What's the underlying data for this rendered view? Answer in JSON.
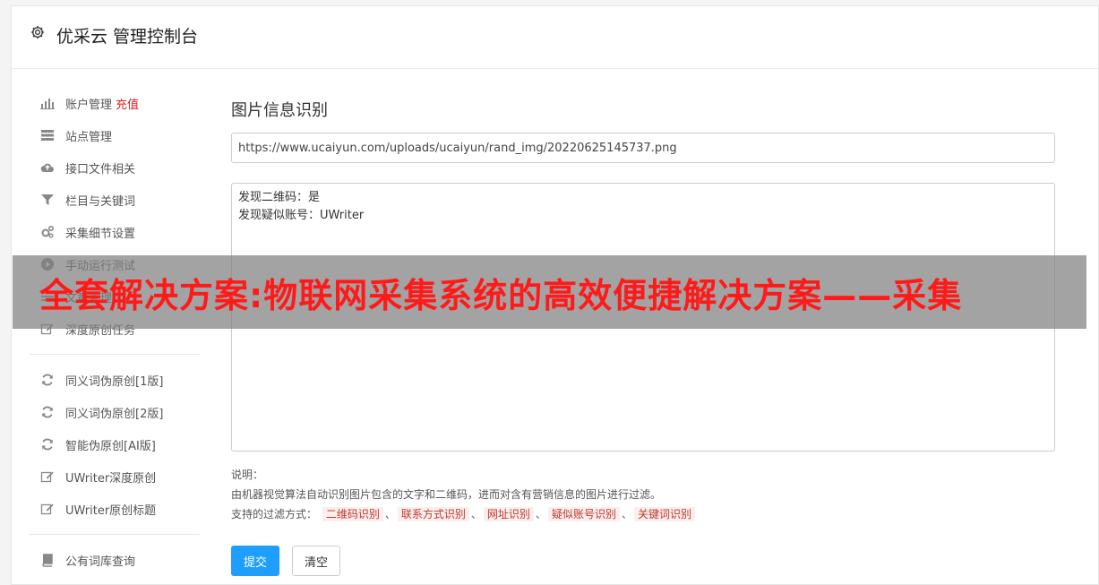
{
  "header": {
    "title": "优采云 管理控制台",
    "icon": "gear-icon"
  },
  "sidebar": {
    "groups": [
      [
        {
          "icon": "bar-chart-icon",
          "label": "账户管理",
          "extra": "充值"
        },
        {
          "icon": "server-icon",
          "label": "站点管理"
        },
        {
          "icon": "cloud-upload-icon",
          "label": "接口文件相关"
        },
        {
          "icon": "filter-icon",
          "label": "栏目与关键词"
        },
        {
          "icon": "cogs-icon",
          "label": "采集细节设置"
        },
        {
          "icon": "play-circle-icon",
          "label": "手动运行测试"
        },
        {
          "icon": "list-icon",
          "label": "文章管理"
        },
        {
          "icon": "edit-icon",
          "label": "深度原创任务"
        }
      ],
      [
        {
          "icon": "refresh-icon",
          "label": "同义词伪原创[1版]"
        },
        {
          "icon": "refresh-icon",
          "label": "同义词伪原创[2版]"
        },
        {
          "icon": "refresh-icon",
          "label": "智能伪原创[AI版]"
        },
        {
          "icon": "edit-icon",
          "label": "UWriter深度原创"
        },
        {
          "icon": "edit-icon",
          "label": "UWriter原创标题"
        }
      ],
      [
        {
          "icon": "book-icon",
          "label": "公有词库查询"
        }
      ]
    ]
  },
  "main": {
    "title": "图片信息识别",
    "url_value": "https://www.ucaiyun.com/uploads/ucaiyun/rand_img/20220625145737.png",
    "result_lines": [
      "发现二维码：是",
      "发现疑似账号：UWriter"
    ],
    "notes_label": "说明：",
    "notes_desc": "由机器视觉算法自动识别图片包含的文字和二维码，进而对含有营销信息的图片进行过滤。",
    "filter_label": "支持的过滤方式：",
    "filter_tags": [
      "二维码识别",
      "联系方式识别",
      "网址识别",
      "疑似账号识别",
      "关键词识别"
    ],
    "tag_separator": "、",
    "submit_label": "提交",
    "clear_label": "清空"
  },
  "overlay": {
    "text": "全套解决方案:物联网采集系统的高效便捷解决方案——采集"
  },
  "colors": {
    "accent": "#1e9fff",
    "recharge": "#e02020",
    "tag": "#c0392b",
    "overlay_text": "#ff1a1a"
  }
}
